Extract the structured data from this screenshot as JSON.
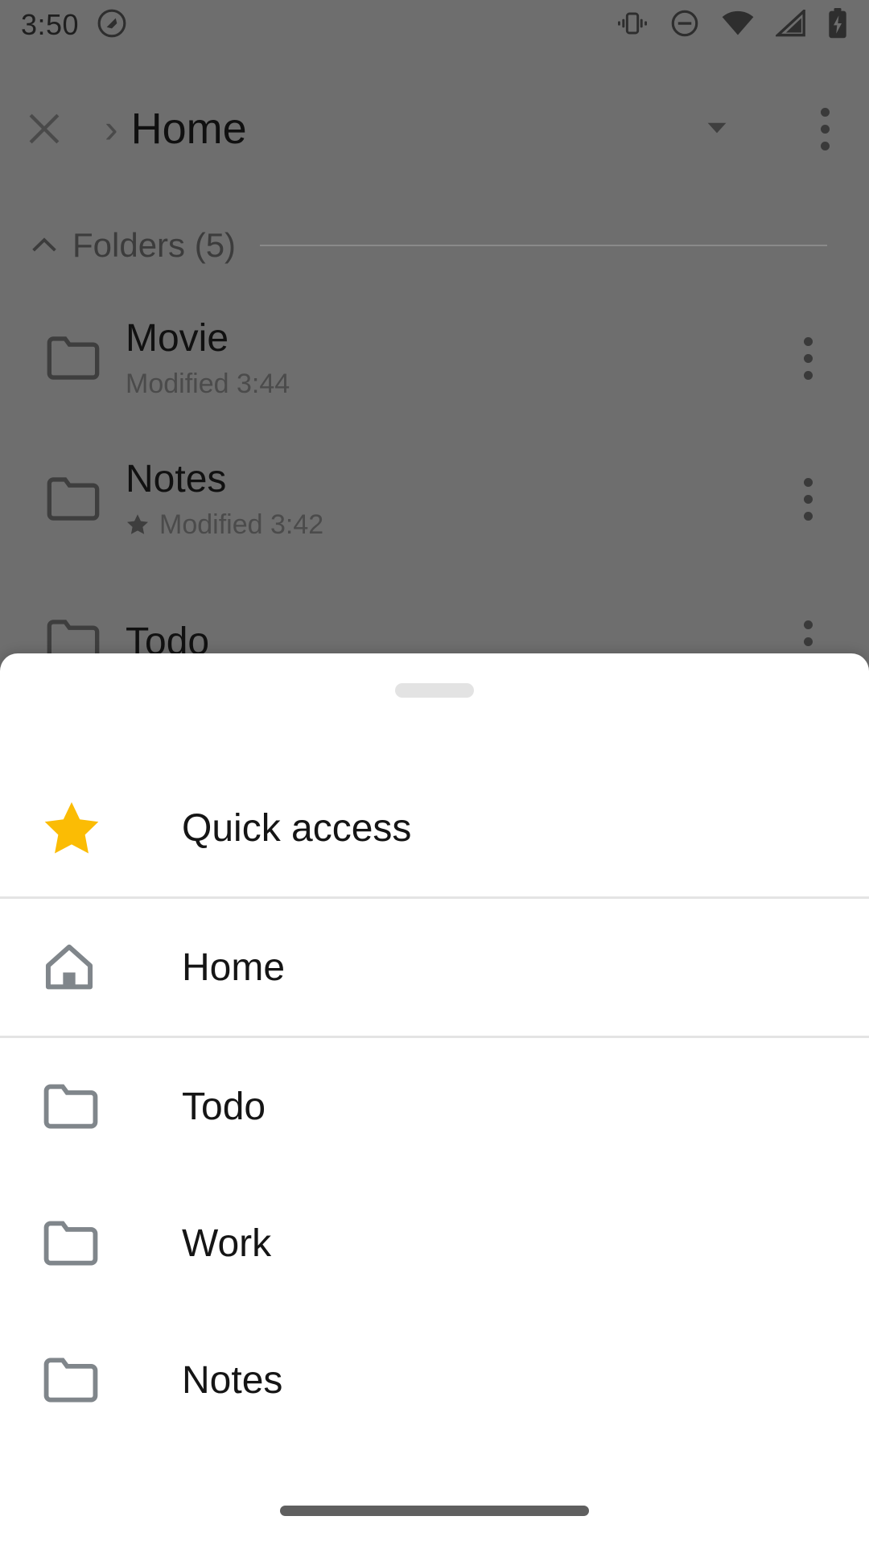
{
  "status_bar": {
    "time": "3:50",
    "left_icons": [
      {
        "name": "screen-rotation-lock-icon",
        "glyph": "rotation-lock"
      }
    ],
    "right_icons": [
      {
        "name": "vibrate-icon",
        "glyph": "vibrate"
      },
      {
        "name": "do-not-disturb-icon",
        "glyph": "minus-circle"
      },
      {
        "name": "wifi-icon",
        "glyph": "wifi"
      },
      {
        "name": "cellular-signal-icon",
        "glyph": "signal"
      },
      {
        "name": "battery-charging-icon",
        "glyph": "battery-charging"
      }
    ],
    "icon_color": "#2e2e2e",
    "text_color": "#1f1f1f"
  },
  "app_bar": {
    "close_label": "Close",
    "breadcrumb_separator": "›",
    "title": "Home",
    "dropdown_label": "Show more locations",
    "overflow_label": "More options"
  },
  "folders_section": {
    "label": "Folders (5)",
    "collapsed": false,
    "collapse_glyph": "chevron-up"
  },
  "file_list": [
    {
      "name": "Movie",
      "subtitle": "Modified 3:44",
      "starred": false,
      "icon": "folder-icon"
    },
    {
      "name": "Notes",
      "subtitle": "Modified 3:42",
      "starred": true,
      "icon": "folder-icon"
    },
    {
      "name": "Todo",
      "subtitle": "",
      "starred": false,
      "icon": "folder-icon"
    }
  ],
  "bottom_sheet": {
    "handle_label": "Drag handle",
    "groups": [
      {
        "group_name": "quick-access",
        "items": [
          {
            "label": "Quick access",
            "icon": "star-icon",
            "icon_color": "#FBBC04"
          }
        ]
      },
      {
        "group_name": "home",
        "items": [
          {
            "label": "Home",
            "icon": "home-icon",
            "icon_color": "#80868B"
          }
        ]
      },
      {
        "group_name": "folders",
        "items": [
          {
            "label": "Todo",
            "icon": "folder-icon",
            "icon_color": "#80868B"
          },
          {
            "label": "Work",
            "icon": "folder-icon",
            "icon_color": "#80868B"
          },
          {
            "label": "Notes",
            "icon": "folder-icon",
            "icon_color": "#80868B"
          }
        ]
      }
    ]
  },
  "navigation_bar": {
    "gesture_pill_label": "Home gesture bar"
  },
  "colors": {
    "scrim": "#6e6e6e",
    "sheet_background": "#ffffff",
    "divider": "#e4e4e4",
    "accent_star": "#FBBC04",
    "icon_gray": "#80868B",
    "primary_text": "#151515"
  }
}
